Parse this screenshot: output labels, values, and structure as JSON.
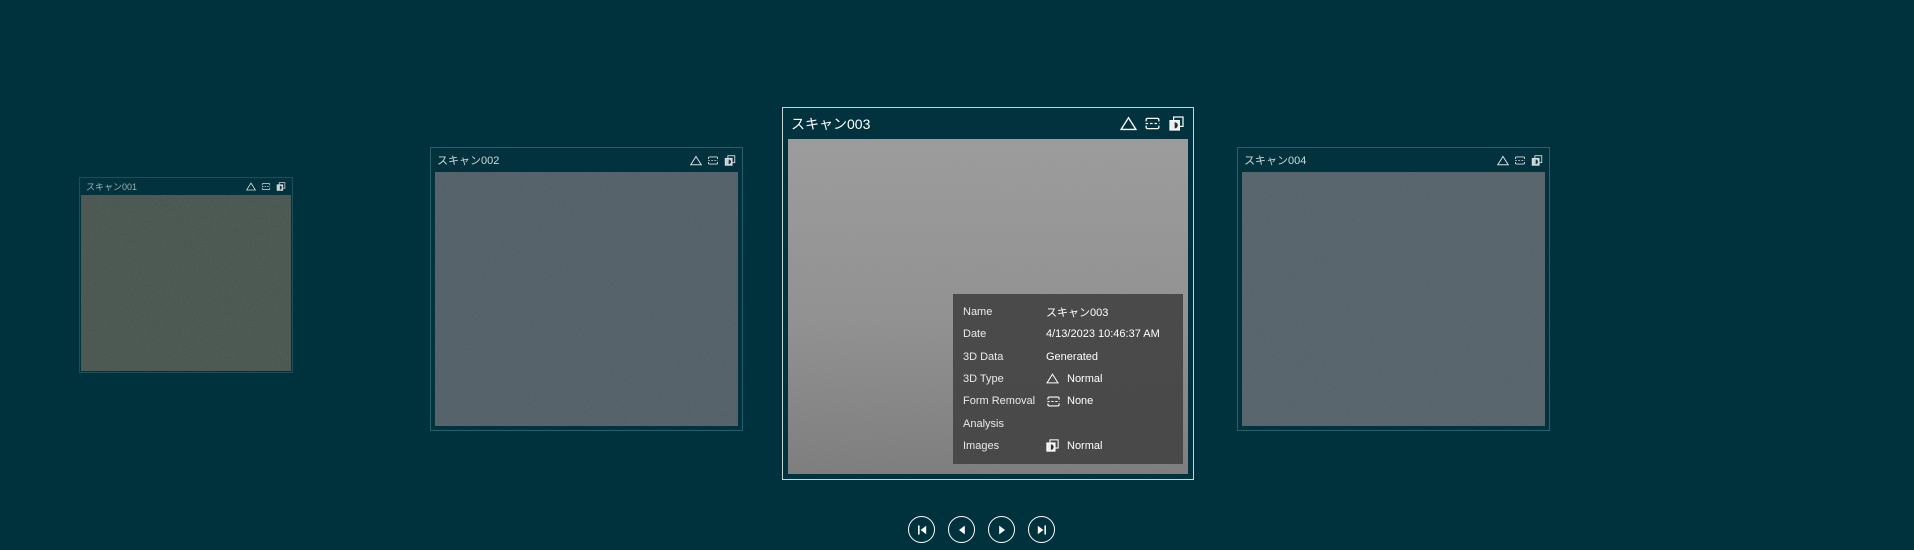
{
  "carousel": {
    "cards": [
      {
        "title": "スキャン001"
      },
      {
        "title": "スキャン002"
      },
      {
        "title": "スキャン003"
      },
      {
        "title": "スキャン004"
      }
    ],
    "card_header_icons": [
      "triangle-icon",
      "form-removal-icon",
      "images-icon"
    ]
  },
  "details_panel": {
    "rows": [
      {
        "label": "Name",
        "value": "スキャン003"
      },
      {
        "label": "Date",
        "value": "4/13/2023 10:46:37 AM"
      },
      {
        "label": "3D Data",
        "value": "Generated"
      },
      {
        "label": "3D Type",
        "value": "Normal",
        "icon": "triangle-icon"
      },
      {
        "label": "Form Removal",
        "value": "None",
        "icon": "form-removal-icon"
      },
      {
        "label": "Analysis",
        "value": ""
      },
      {
        "label": "Images",
        "value": "Normal",
        "icon": "images-icon"
      }
    ]
  },
  "navigation": {
    "buttons": [
      {
        "name": "skip-to-first",
        "icon": "skip-to-first-icon"
      },
      {
        "name": "previous",
        "icon": "previous-icon"
      },
      {
        "name": "next",
        "icon": "next-icon"
      },
      {
        "name": "skip-to-last",
        "icon": "skip-to-last-icon"
      }
    ]
  },
  "colors": {
    "background": "#00323d",
    "active_card_border": "#c9d6d8",
    "inactive_card_border": "#27616c",
    "details_panel_bg": "#424242",
    "nav_button_border": "#ffffff"
  }
}
